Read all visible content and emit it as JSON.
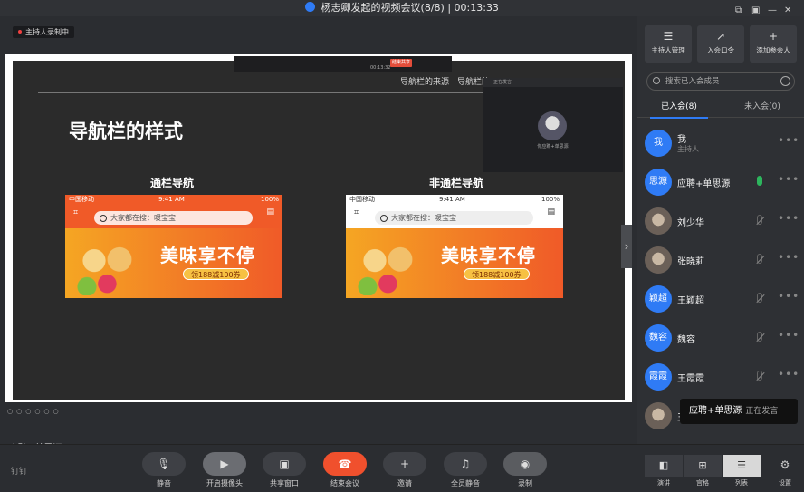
{
  "window": {
    "title": "杨志卿发起的视频会议(8/8) | 00:13:33"
  },
  "stage": {
    "recording_badge": "主持人录制中",
    "active_speaker_label": "应聘+单思源"
  },
  "slide": {
    "top_links": "导航栏的来源　导航栏的",
    "title": "导航栏的样式",
    "left_col_title": "通栏导航",
    "right_col_title": "非通栏导航",
    "phone": {
      "carrier": "中国移动",
      "time": "9:41 AM",
      "battery": "100%",
      "search_placeholder": "大家都在搜：暖宝宝",
      "scan_label": "扫一扫",
      "msg_label": "消息",
      "slogan": "美味享不停",
      "coupon": "领188减100券"
    },
    "mini_toolbar": {
      "timer": "00:13:32",
      "end_label": "结束共享"
    },
    "video_tile": {
      "header": "正在发言",
      "name": "你应聘+单思源"
    }
  },
  "controls": {
    "logo": "钉钉",
    "buttons": [
      {
        "label": "静音",
        "icon": "mic-icon",
        "glyph": "🎙"
      },
      {
        "label": "开启摄像头",
        "icon": "camera-icon",
        "glyph": "▶"
      },
      {
        "label": "共享窗口",
        "icon": "share-icon",
        "glyph": "▣"
      },
      {
        "label": "结束会议",
        "icon": "hangup-icon",
        "glyph": "☎"
      },
      {
        "label": "邀请",
        "icon": "invite-icon",
        "glyph": "+"
      },
      {
        "label": "全员静音",
        "icon": "mute-all-icon",
        "glyph": "♫"
      },
      {
        "label": "录制",
        "icon": "record-icon",
        "glyph": "◉"
      }
    ]
  },
  "panel": {
    "actions": [
      {
        "label": "主持人管理",
        "icon": "host-manage-icon",
        "glyph": "☰"
      },
      {
        "label": "入会口令",
        "icon": "join-code-icon",
        "glyph": "↗"
      },
      {
        "label": "添加参会人",
        "icon": "add-participant-icon",
        "glyph": "+"
      }
    ],
    "search_placeholder": "搜索已入会成员",
    "tab_joined": "已入会(8)",
    "tab_not_joined": "未入会(0)",
    "members": [
      {
        "name": "我",
        "sub": "主持人",
        "avatar_text": "我",
        "photo": false,
        "mic": "none"
      },
      {
        "name": "应聘+单思源",
        "sub": "",
        "avatar_text": "思源",
        "photo": false,
        "mic": "on"
      },
      {
        "name": "刘少华",
        "sub": "",
        "avatar_text": "",
        "photo": true,
        "mic": "off"
      },
      {
        "name": "张晓莉",
        "sub": "",
        "avatar_text": "",
        "photo": true,
        "mic": "off"
      },
      {
        "name": "王颖超",
        "sub": "",
        "avatar_text": "颖超",
        "photo": false,
        "mic": "off"
      },
      {
        "name": "魏容",
        "sub": "",
        "avatar_text": "魏容",
        "photo": false,
        "mic": "off"
      },
      {
        "name": "王霞霞",
        "sub": "",
        "avatar_text": "霞霞",
        "photo": false,
        "mic": "off"
      },
      {
        "name": "王志芬",
        "sub": "",
        "avatar_text": "",
        "photo": true,
        "mic": "off"
      }
    ],
    "tooltip_name": "应聘+单思源",
    "tooltip_status": "正在发言",
    "views": [
      {
        "label": "演讲",
        "glyph": "◧"
      },
      {
        "label": "宫格",
        "glyph": "⊞"
      },
      {
        "label": "列表",
        "glyph": "☰"
      }
    ],
    "settings_label": "设置"
  }
}
